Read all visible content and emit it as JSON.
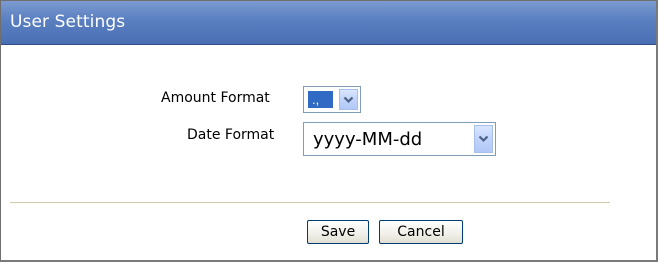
{
  "window": {
    "title": "User Settings"
  },
  "form": {
    "amount_format": {
      "label": "Amount Format",
      "selected_value": ".,"
    },
    "date_format": {
      "label": "Date Format",
      "selected_value": "yyyy-MM-dd"
    }
  },
  "actions": {
    "save_label": "Save",
    "cancel_label": "Cancel"
  },
  "colors": {
    "titlebar": "#5a7fc0",
    "selection_highlight": "#316ac5",
    "field_border": "#7f9db9"
  },
  "icons": {
    "dropdown": "chevron-down-icon"
  }
}
